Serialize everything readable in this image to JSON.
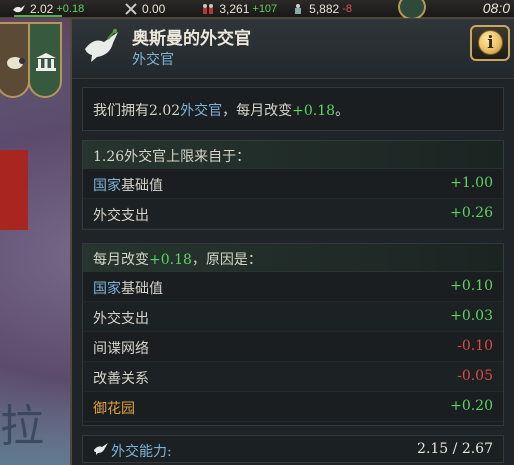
{
  "topbar": {
    "diplomats": {
      "value": "2.02",
      "change": "+0.18",
      "icon": "dove-icon"
    },
    "military": {
      "value": "0.00",
      "icon": "crossed-swords-icon"
    },
    "manpower": {
      "value": "3,261",
      "change": "+107",
      "icon": "soldiers-icon"
    },
    "troops": {
      "value": "5,882",
      "change": "-8",
      "icon": "army-icon"
    },
    "clock": "08:0"
  },
  "map": {
    "label": "拉"
  },
  "tooltip": {
    "title": "奥斯曼的外交官",
    "subtitle": "外交官",
    "summary": {
      "prefix": "我们拥有",
      "amount": "2.02",
      "resource": "外交官",
      "middle": "，每月改变",
      "change": "+0.18",
      "suffix": "。"
    },
    "limit": {
      "header": "1.26外交官上限来自于：",
      "rows": [
        {
          "label_blue": "国家",
          "label_rest": "基础值",
          "value": "+1.00"
        },
        {
          "label_blue": "",
          "label_rest": "外交支出",
          "value": "+0.26"
        }
      ]
    },
    "monthly": {
      "header_prefix": "每月改变",
      "header_value": "+0.18",
      "header_suffix": "，原因是：",
      "rows": [
        {
          "label_blue": "国家",
          "label_rest": "基础值",
          "value": "+0.10",
          "tone": "positive"
        },
        {
          "label_blue": "",
          "label_rest": "外交支出",
          "value": "+0.03",
          "tone": "positive"
        },
        {
          "label_blue": "",
          "label_rest": "间谍网络",
          "value": "-0.10",
          "tone": "negative"
        },
        {
          "label_blue": "",
          "label_rest": "改善关系",
          "value": "-0.05",
          "tone": "negative"
        },
        {
          "label_blue": "",
          "label_rest": "御花园",
          "value": "+0.20",
          "tone": "positive",
          "label_color": "orange"
        }
      ]
    },
    "footer": {
      "label": "外交能力:",
      "value": "2.15 / 2.67",
      "icon": "dove-icon"
    }
  },
  "colors": {
    "positive": "#5fd35f",
    "negative": "#dd4b4b",
    "link_blue": "#7fb3d6",
    "orange": "#e0a040",
    "panel_bg": "#1f2428"
  }
}
